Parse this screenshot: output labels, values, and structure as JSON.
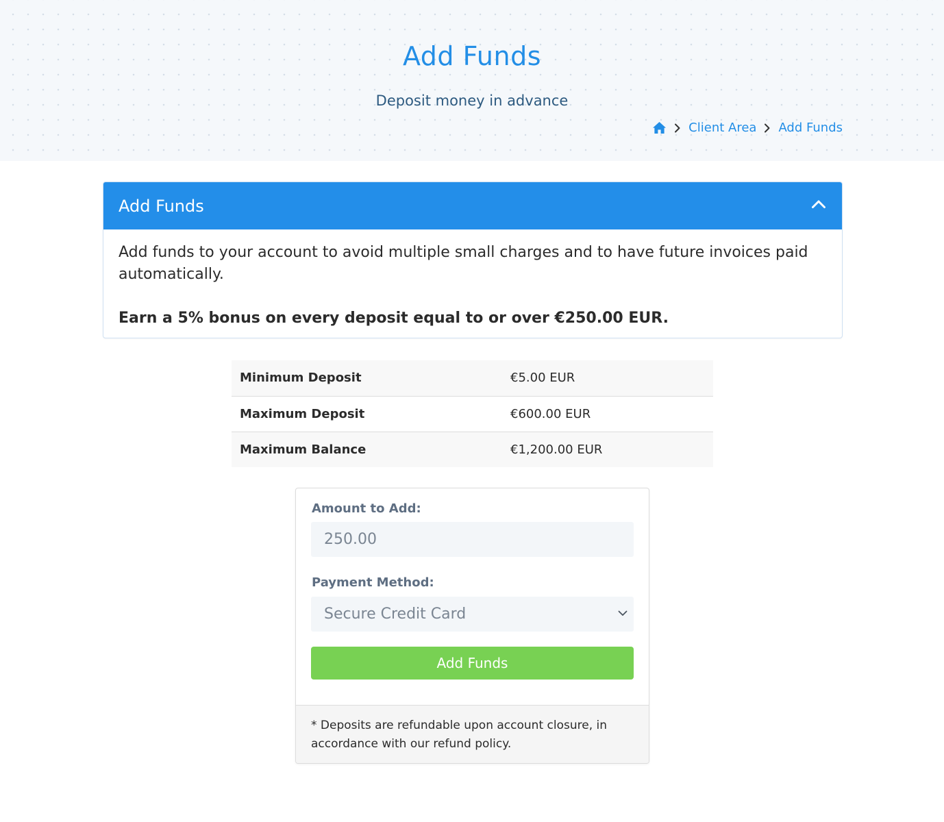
{
  "header": {
    "title": "Add Funds",
    "subtitle": "Deposit money in advance",
    "breadcrumb": {
      "home_icon": "home-icon",
      "items": [
        "Client Area",
        "Add Funds"
      ]
    }
  },
  "panel": {
    "title": "Add Funds",
    "toggle_icon": "chevron-up-icon",
    "description": "Add funds to your account to avoid multiple small charges and to have future invoices paid automatically.",
    "bonus": "Earn a 5% bonus on every deposit equal to or over €250.00 EUR."
  },
  "limits": [
    {
      "label": "Minimum Deposit",
      "value": "€5.00 EUR"
    },
    {
      "label": "Maximum Deposit",
      "value": "€600.00 EUR"
    },
    {
      "label": "Maximum Balance",
      "value": "€1,200.00 EUR"
    }
  ],
  "form": {
    "amount_label": "Amount to Add:",
    "amount_value": "250.00",
    "method_label": "Payment Method:",
    "method_selected": "Secure Credit Card",
    "submit_label": "Add Funds",
    "footnote": "* Deposits are refundable upon account closure, in accordance with our refund policy."
  },
  "colors": {
    "accent": "#238ee6",
    "panel_header": "#238ee9",
    "button": "#78d153"
  }
}
